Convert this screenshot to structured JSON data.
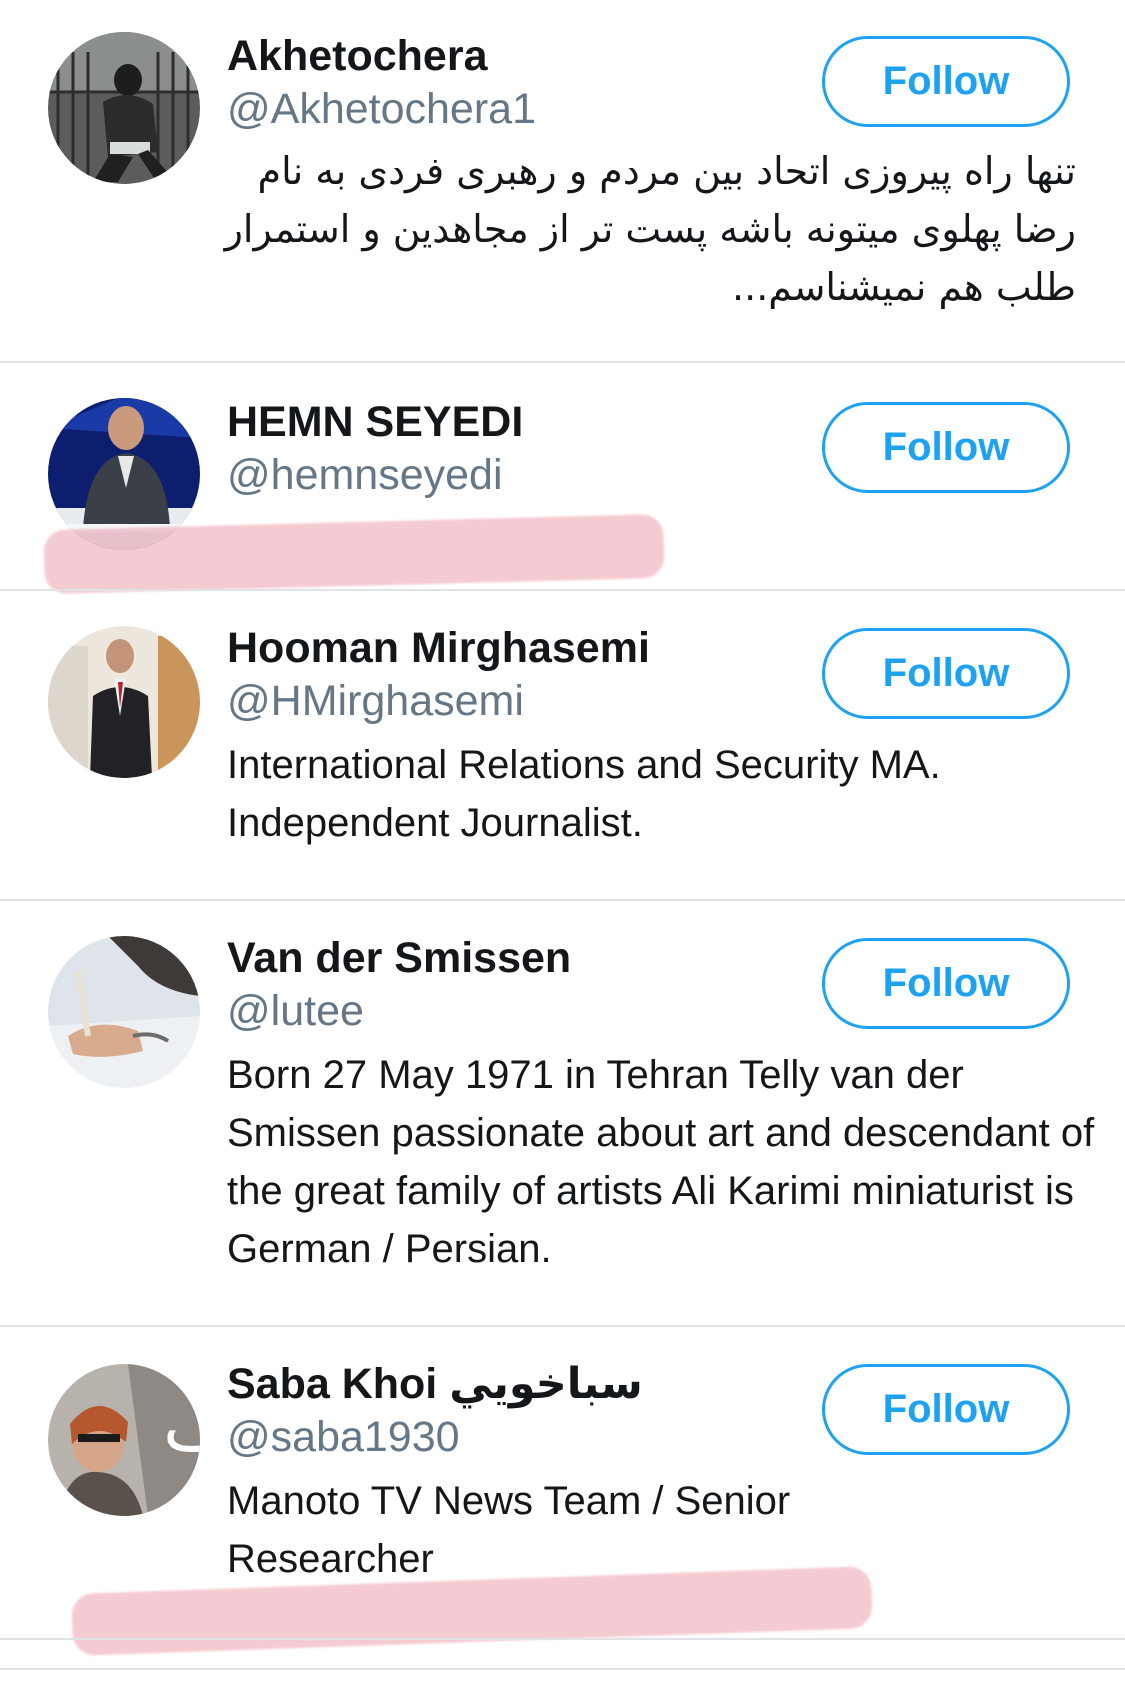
{
  "colors": {
    "accent": "#1da1f2",
    "name_text": "#14171a",
    "handle_text": "#657786",
    "divider": "#dfe3e6",
    "highlight": "#e88296"
  },
  "users": [
    {
      "name": "Akhetochera",
      "handle": "@Akhetochera1",
      "bio": "تنها راه پیروزی اتحاد بین مردم و رهبری فردی به نام رضا پهلوی میتونه باشه پست تر از مجاهدین و استمرار طلب هم نمیشناسم...",
      "follow_label": "Follow"
    },
    {
      "name": "HEMN SEYEDI",
      "handle": "@hemnseyedi",
      "bio": "",
      "follow_label": "Follow"
    },
    {
      "name": "Hooman Mirghasemi",
      "handle": "@HMirghasemi",
      "bio": "International Relations and Security MA. Independent Journalist.",
      "follow_label": "Follow"
    },
    {
      "name": "Van der Smissen",
      "handle": "@lutee",
      "bio": "Born 27 May 1971 in Tehran Telly van der Smissen passionate about art and descendant of the great family of artists Ali Karimi miniaturist is German / Persian.",
      "follow_label": "Follow"
    },
    {
      "name": "Saba Khoi سباخويي",
      "handle": "@saba1930",
      "bio": "Manoto TV News Team / Senior Researcher",
      "follow_label": "Follow"
    }
  ]
}
